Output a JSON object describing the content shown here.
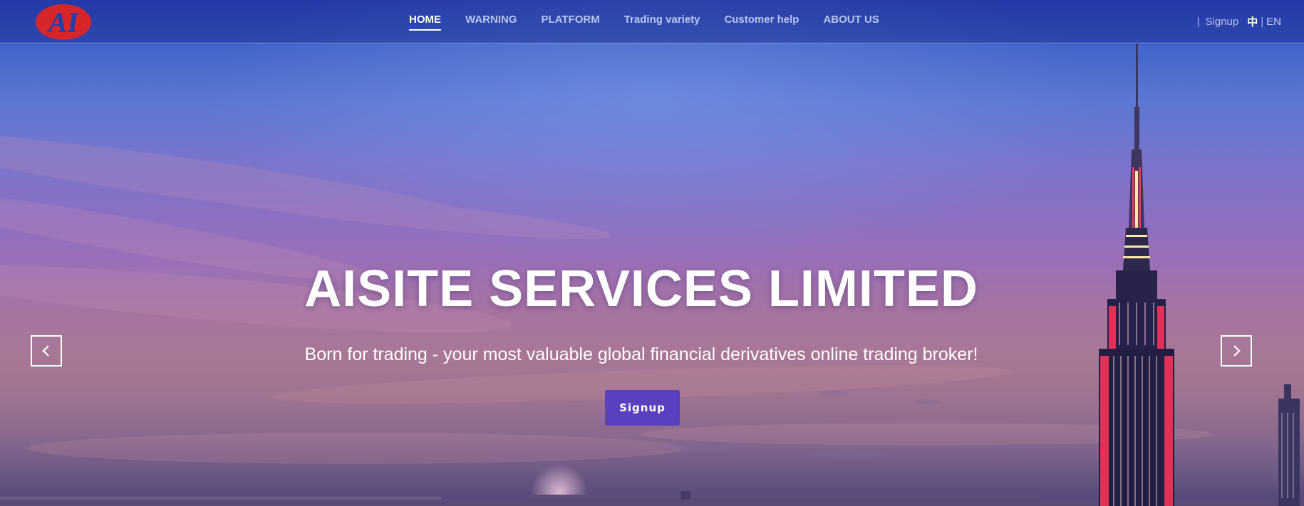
{
  "header": {
    "logo_text": "AI",
    "nav": [
      {
        "label": "HOME",
        "active": true
      },
      {
        "label": "WARNING",
        "active": false
      },
      {
        "label": "PLATFORM",
        "active": false
      },
      {
        "label": "Trading variety",
        "active": false
      },
      {
        "label": "Customer help",
        "active": false
      },
      {
        "label": "ABOUT US",
        "active": false
      }
    ],
    "separator": "|",
    "signup_label": "Signup",
    "lang_zh": "中",
    "lang_separator": "|",
    "lang_en": "EN"
  },
  "hero": {
    "title": "AISITE SERVICES LIMITED",
    "subtitle": "Born for trading - your most valuable global financial derivatives online trading broker!",
    "cta_label": "Signup",
    "prev_icon": "chevron-left-icon",
    "next_icon": "chevron-right-icon"
  },
  "colors": {
    "header_bg": "#1c3496",
    "nav_active": "#ffffff",
    "nav_inactive": "#b8c3ee",
    "cta_bg": "#5a3fbf",
    "logo_red": "#d6262a",
    "logo_blue": "#1f3fb0"
  }
}
